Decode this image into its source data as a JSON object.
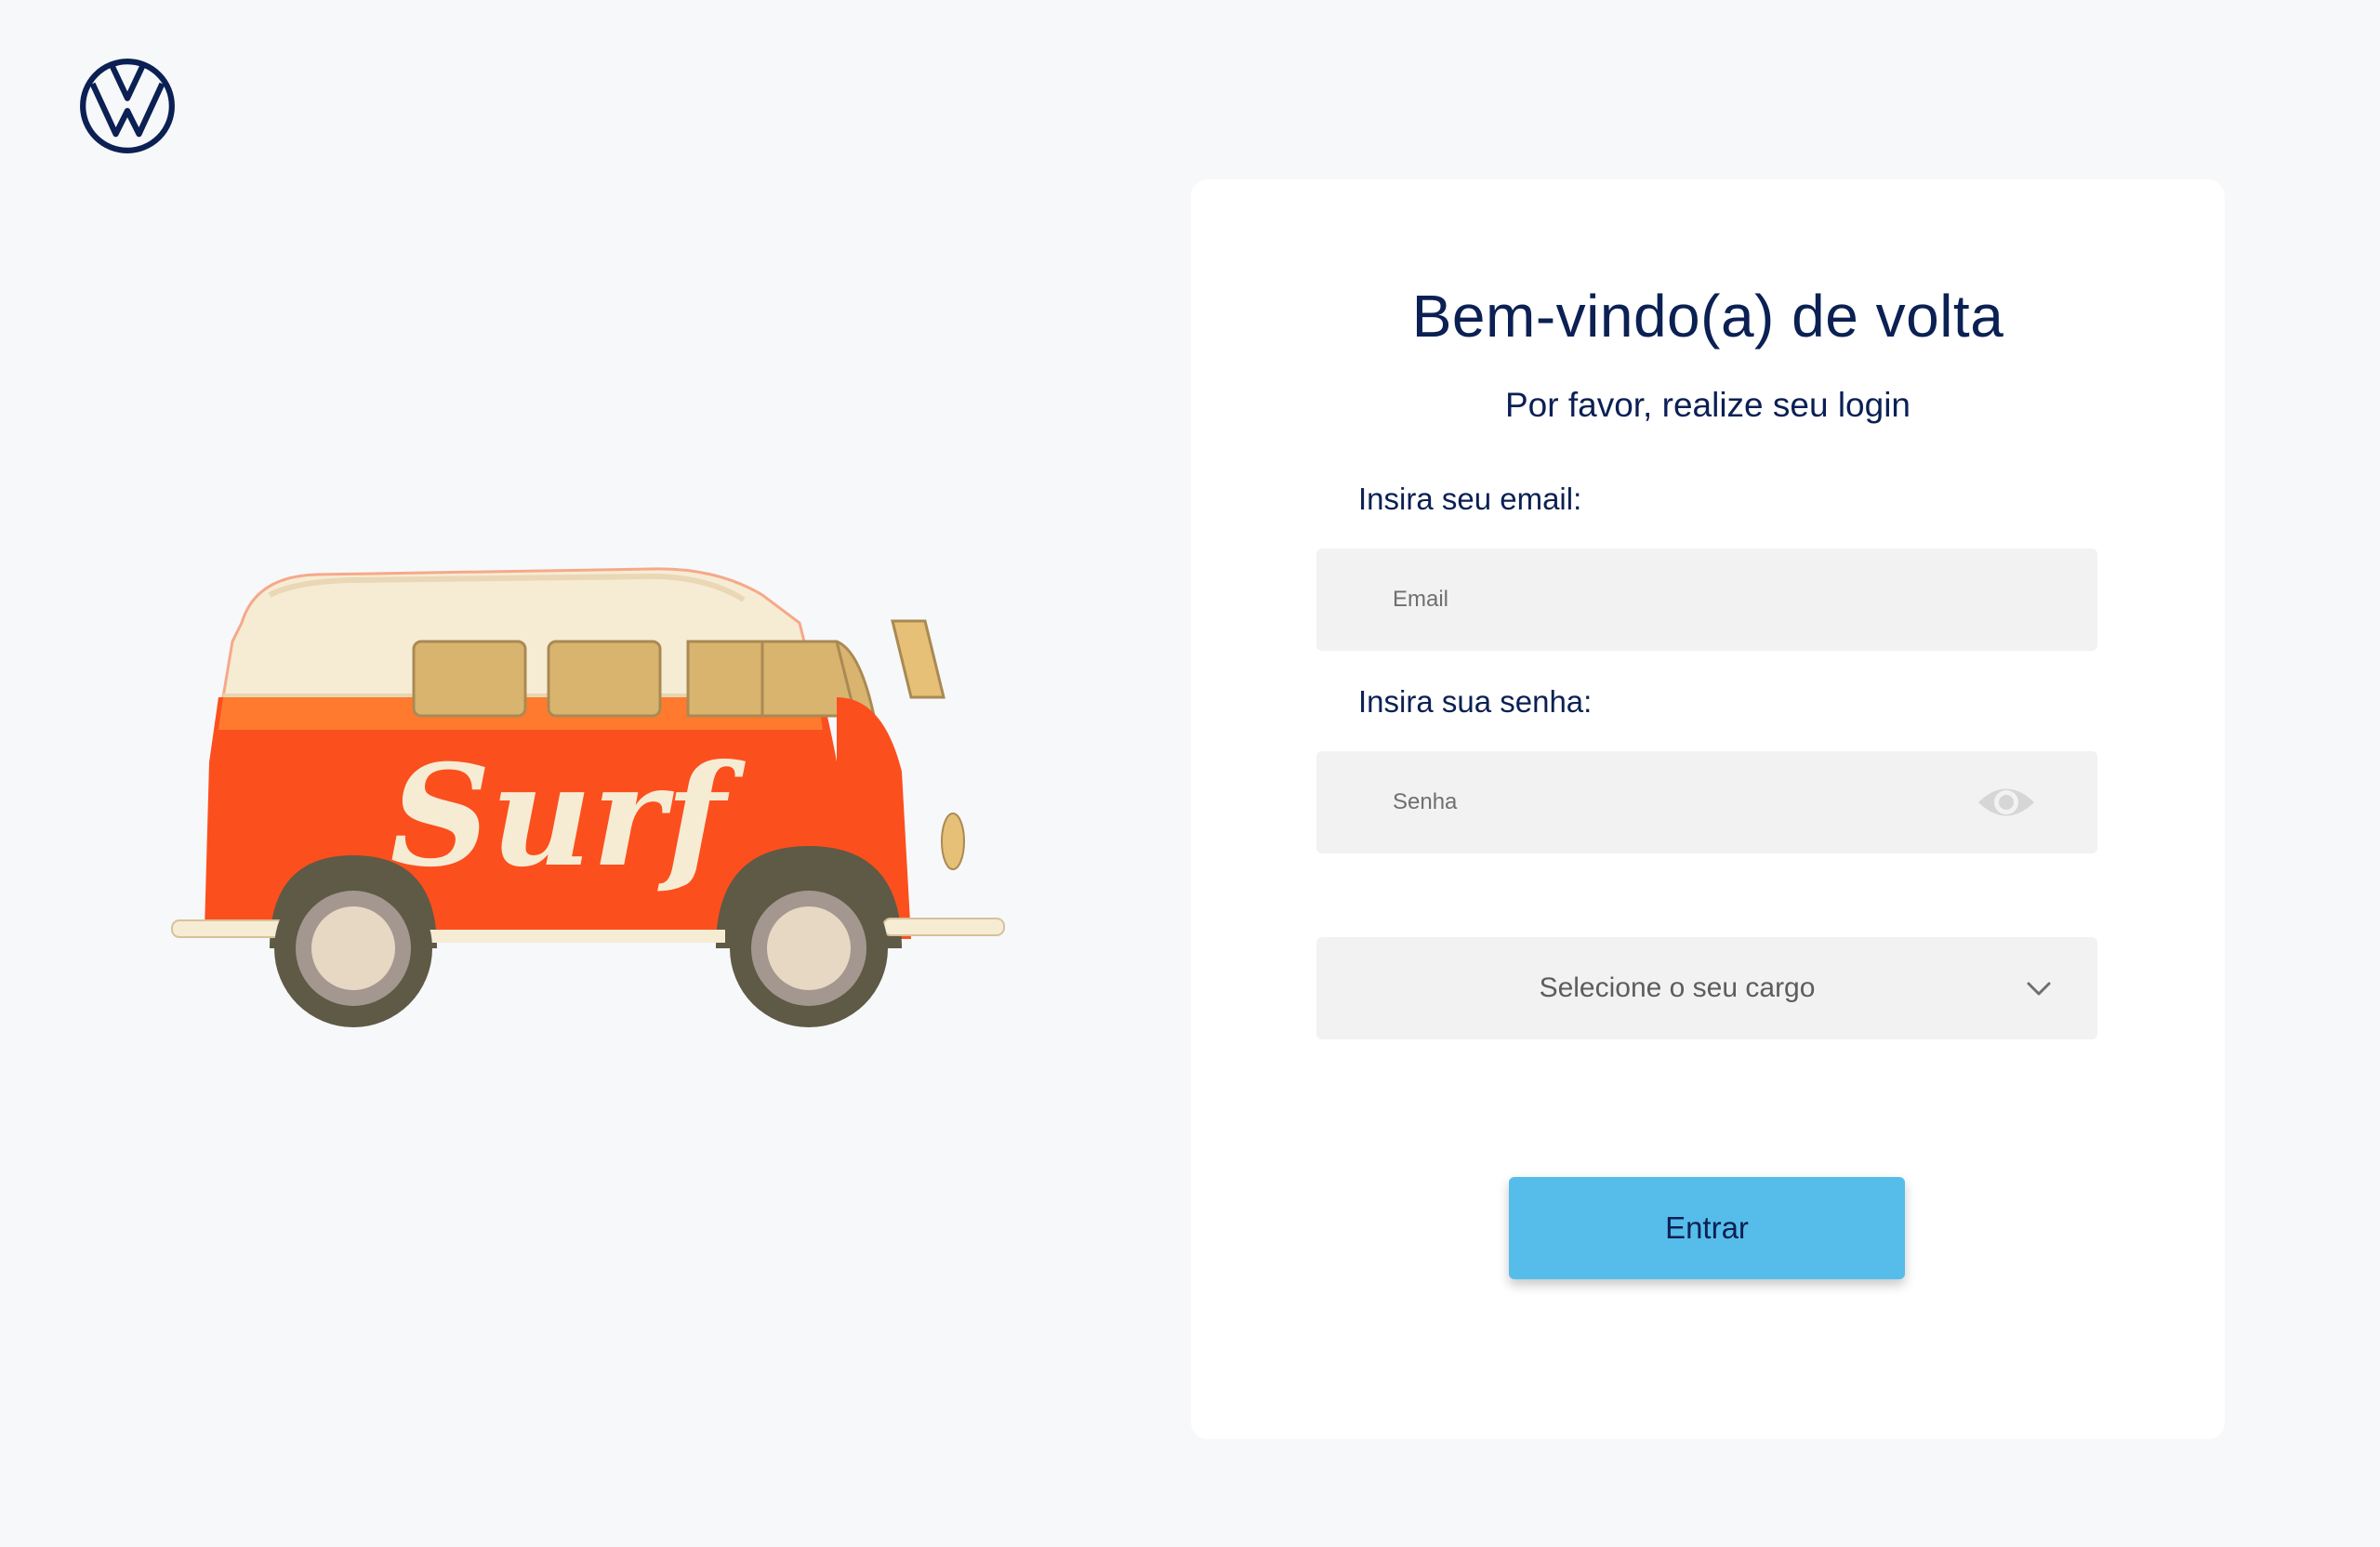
{
  "brand": {
    "logo_icon": "volkswagen-logo-icon",
    "logo_color": "#0b2053"
  },
  "illustration": {
    "icon": "surf-van-illustration",
    "text": "Surf"
  },
  "login": {
    "title": "Bem-vindo(a) de volta",
    "subtitle": "Por favor, realize seu login",
    "email_label": "Insira seu email:",
    "email_placeholder": "Email",
    "password_label": "Insira sua senha:",
    "password_placeholder": "Senha",
    "password_toggle_icon": "eye-icon",
    "role_select_text": "Selecione o seu cargo",
    "role_select_icon": "chevron-down-icon",
    "submit_label": "Entrar"
  },
  "colors": {
    "background": "#f7f8fa",
    "card": "#ffffff",
    "text_primary": "#0b2053",
    "input_bg": "#f3f2f3",
    "button_bg": "#56bdea",
    "van_orange": "#fc4f1e",
    "van_cream": "#f6ecd4"
  }
}
